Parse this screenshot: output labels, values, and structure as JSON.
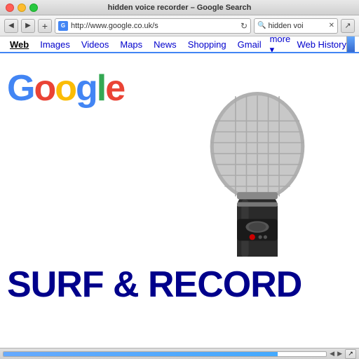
{
  "titleBar": {
    "title": "hidden voice recorder – Google Search"
  },
  "toolbar": {
    "backLabel": "◀",
    "forwardLabel": "▶",
    "plusLabel": "+",
    "addressUrl": "http://www.google.co.uk/s",
    "refreshLabel": "↻",
    "searchQuery": "hidden voi",
    "pageIconLabel": "↗"
  },
  "navBar": {
    "links": [
      {
        "label": "Web",
        "active": true
      },
      {
        "label": "Images",
        "active": false
      },
      {
        "label": "Videos",
        "active": false
      },
      {
        "label": "Maps",
        "active": false
      },
      {
        "label": "News",
        "active": false
      },
      {
        "label": "Shopping",
        "active": false
      },
      {
        "label": "Gmail",
        "active": false
      },
      {
        "label": "more",
        "active": false
      }
    ],
    "moreLabel": "▾",
    "webHistoryLabel": "Web History"
  },
  "googleLogo": {
    "g": "G",
    "o1": "o",
    "o2": "o",
    "g2": "g",
    "l": "l",
    "e": "e"
  },
  "bottomBanner": {
    "text": "SURF & RECORD"
  },
  "statusBar": {
    "scrollLeft": "◀",
    "scrollRight": "▶",
    "endLabel": "↗"
  }
}
